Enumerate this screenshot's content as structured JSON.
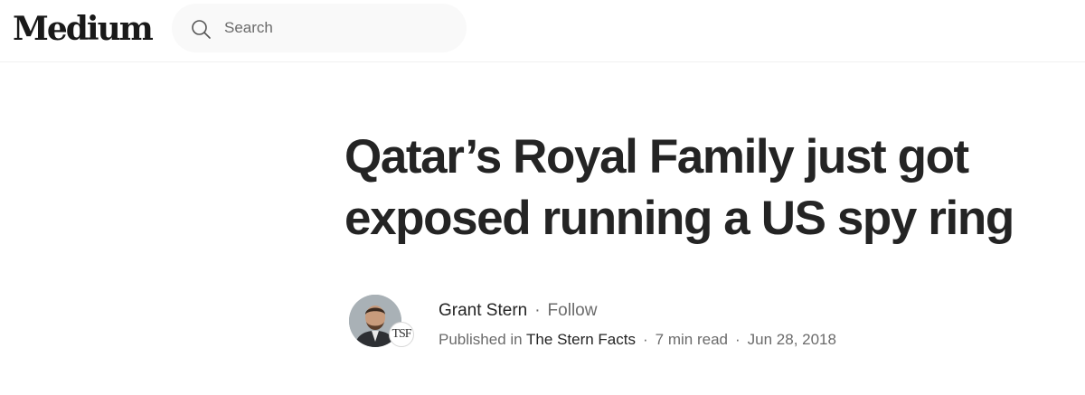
{
  "header": {
    "logo_text": "Medium",
    "search_placeholder": "Search"
  },
  "article": {
    "title_line1": "Qatar’s Royal Family just got",
    "title_line2": "exposed running a US spy ring"
  },
  "byline": {
    "author_name": "Grant Stern",
    "separator": "·",
    "follow_label": "Follow",
    "published_in_label": "Published in",
    "publication_name": "The Stern Facts",
    "publication_badge": "TSF",
    "read_time": "7 min read",
    "date": "Jun 28, 2018"
  }
}
